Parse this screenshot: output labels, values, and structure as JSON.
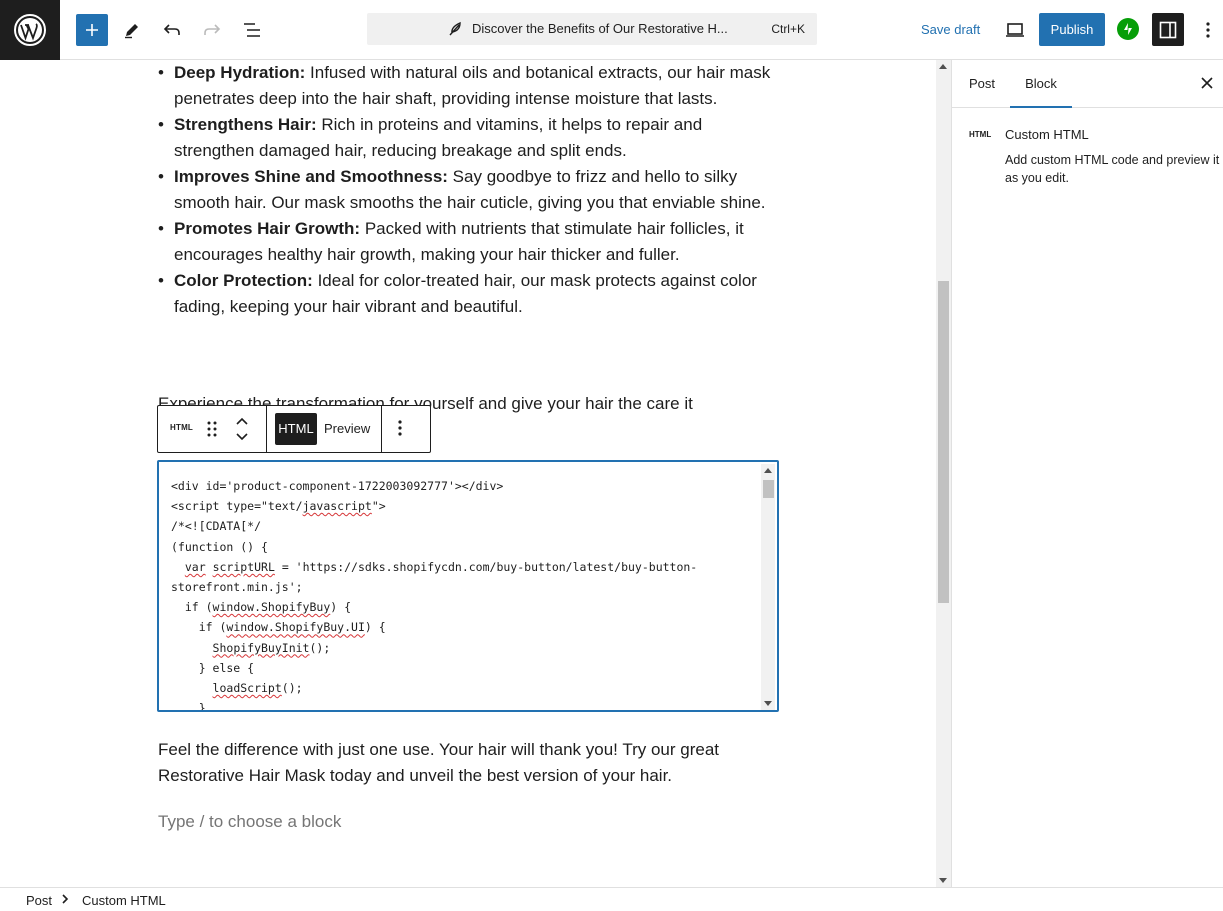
{
  "topbar": {
    "document_title": "Discover the Benefits of Our Restorative H...",
    "shortcut": "Ctrl+K",
    "save_draft": "Save draft",
    "publish": "Publish"
  },
  "content": {
    "benefits": [
      {
        "title": "Deep Hydration:",
        "text": " Infused with natural oils and botanical extracts, our hair mask penetrates deep into the hair shaft, providing intense moisture that lasts."
      },
      {
        "title": "Strengthens Hair:",
        "text": " Rich in proteins and vitamins, it helps to repair and strengthen damaged hair, reducing breakage and split ends."
      },
      {
        "title": "Improves Shine and Smoothness:",
        "text": " Say goodbye to frizz and hello to silky smooth hair. Our mask smooths the hair cuticle, giving you that enviable shine."
      },
      {
        "title": "Promotes Hair Growth:",
        "text": " Packed with nutrients that stimulate hair follicles, it encourages healthy hair growth, making your hair thicker and fuller."
      },
      {
        "title": "Color Protection:",
        "text": " Ideal for color-treated hair, our mask protects against color fading, keeping your hair vibrant and beautiful."
      }
    ],
    "paragraph_cut": "Experience the transformation for yourself and give your hair the care it",
    "paragraph_end": "Feel the difference with just one use. Your hair will thank you! Try our great Restorative Hair Mask today and unveil the best version of your hair.",
    "appender_placeholder": "Type / to choose a block"
  },
  "block_toolbar": {
    "block_icon_label": "HTML",
    "html_tab": "HTML",
    "preview_tab": "Preview"
  },
  "code": {
    "line1": "<div id='product-component-1722003092777'></div>",
    "line2_a": "<script type=\"text/",
    "line2_b": "javascript",
    "line2_c": "\">",
    "line3": "/*<![CDATA[*/",
    "line4": "(function () {",
    "line5_a": "  ",
    "line5_b": "var",
    "line5_c": " ",
    "line5_d": "scriptURL",
    "line5_e": " = 'https://sdks.shopifycdn.com/buy-button/latest/buy-button-",
    "line6": "storefront.min.js';",
    "line7_a": "  if (",
    "line7_b": "window.ShopifyBuy",
    "line7_c": ") {",
    "line8_a": "    if (",
    "line8_b": "window.ShopifyBuy.UI",
    "line8_c": ") {",
    "line9_a": "      ",
    "line9_b": "ShopifyBuyInit",
    "line9_c": "();",
    "line10": "    } else {",
    "line11_a": "      ",
    "line11_b": "loadScript",
    "line11_c": "();",
    "line12": "    }"
  },
  "sidebar": {
    "tab_post": "Post",
    "tab_block": "Block",
    "block_icon_label": "HTML",
    "block_title": "Custom HTML",
    "block_description": "Add custom HTML code and preview it as you edit."
  },
  "footer": {
    "crumb_post": "Post",
    "crumb_current": "Custom HTML"
  },
  "colors": {
    "accent": "#2271b1",
    "dark": "#1e1e1e",
    "jetpack": "#069e08",
    "spellcheck": "#d63638"
  }
}
